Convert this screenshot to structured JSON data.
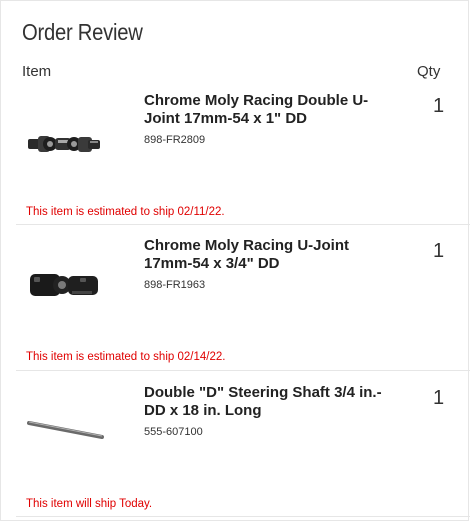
{
  "header": {
    "title": "Order Review",
    "col_item": "Item",
    "col_qty": "Qty"
  },
  "items": [
    {
      "name": "Chrome Moly Racing Double U-Joint 17mm-54 x 1\" DD",
      "sku": "898-FR2809",
      "qty": "1",
      "ship": "This item is estimated to ship 02/11/22.",
      "image_icon": "double-u-joint-icon"
    },
    {
      "name": "Chrome Moly Racing U-Joint 17mm-54 x 3/4\" DD",
      "sku": "898-FR1963",
      "qty": "1",
      "ship": "This item is estimated to ship 02/14/22.",
      "image_icon": "u-joint-icon"
    },
    {
      "name": "Double \"D\" Steering Shaft 3/4 in.-DD x 18 in. Long",
      "sku": "555-607100",
      "qty": "1",
      "ship": "This item will ship Today.",
      "image_icon": "steering-shaft-icon"
    }
  ],
  "colors": {
    "ship_text": "#e00000",
    "border": "#e6e6e6"
  }
}
